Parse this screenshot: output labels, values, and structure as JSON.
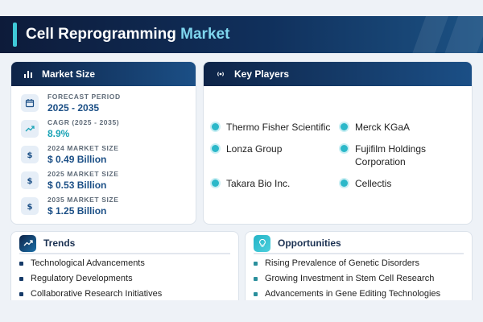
{
  "header": {
    "title_main": "Cell Reprogramming",
    "title_highlight": "Market"
  },
  "market_size": {
    "title": "Market Size",
    "icon": "bar-chart-icon",
    "rows": [
      {
        "icon": "calendar-icon",
        "label": "FORECAST PERIOD",
        "value": "2025 - 2035"
      },
      {
        "icon": "trending-up-icon",
        "label": "CAGR (2025 - 2035)",
        "value": "8.9%"
      },
      {
        "icon": "dollar-icon",
        "label": "2024 MARKET SIZE",
        "value": "$ 0.49 Billion"
      },
      {
        "icon": "dollar-icon",
        "label": "2025 MARKET SIZE",
        "value": "$ 0.53 Billion"
      },
      {
        "icon": "dollar-icon",
        "label": "2035 MARKET SIZE",
        "value": "$ 1.25 Billion"
      }
    ]
  },
  "key_players": {
    "title": "Key Players",
    "icon": "broadcast-icon",
    "items": [
      "Thermo Fisher Scientific",
      "Merck KGaA",
      "Lonza Group",
      "Fujifilm Holdings Corporation",
      "Takara Bio Inc.",
      "Cellectis"
    ]
  },
  "trends": {
    "title": "Trends",
    "icon": "trending-up-icon",
    "items": [
      "Technological Advancements",
      "Regulatory Developments",
      "Collaborative Research Initiatives"
    ]
  },
  "opportunities": {
    "title": "Opportunities",
    "icon": "lightbulb-icon",
    "items": [
      "Rising Prevalence of Genetic Disorders",
      "Growing Investment in Stem Cell Research",
      "Advancements in Gene Editing Technologies"
    ]
  },
  "colors": {
    "navy": "#0e2448",
    "blue": "#1b4f86",
    "teal": "#2bb8c9",
    "light_cyan": "#7fd6ee"
  }
}
